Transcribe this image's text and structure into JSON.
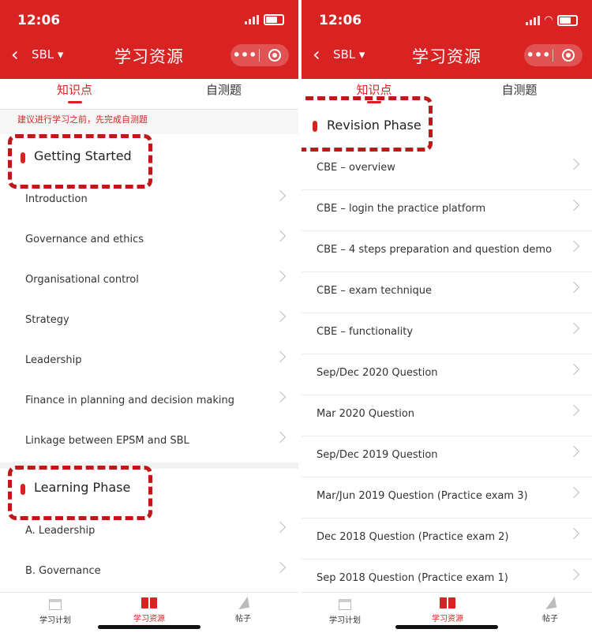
{
  "status": {
    "time": "12:06"
  },
  "nav": {
    "back_icon": "‹",
    "dropdown": "SBL ▾",
    "title": "学习资源",
    "more": "•••"
  },
  "tabs": [
    "知识点",
    "自测题"
  ],
  "left": {
    "notice": "建议进行学习之前，先完成自测题",
    "section1": "Getting Started",
    "items1": [
      "Introduction",
      "Governance and ethics",
      "Organisational control",
      "Strategy",
      "Leadership",
      "Finance in planning and decision making",
      "Linkage between EPSM and SBL"
    ],
    "section2": "Learning Phase",
    "items2": [
      "A.  Leadership",
      "B.  Governance"
    ]
  },
  "right": {
    "section": "Revision Phase",
    "items": [
      "CBE – overview",
      "CBE – login the practice platform",
      "CBE – 4 steps preparation and question demo",
      "CBE – exam technique",
      "CBE – functionality",
      "Sep/Dec 2020 Question",
      "Mar 2020 Question",
      "Sep/Dec 2019 Question",
      "Mar/Jun 2019 Question (Practice exam 3)",
      "Dec 2018 Question (Practice exam 2)",
      "Sep 2018 Question (Practice exam 1)"
    ]
  },
  "tabbar": [
    "学习计划",
    "学习资源",
    "帖子"
  ],
  "colors": {
    "accent": "#d92222",
    "highlight_dash": "#c01818"
  }
}
